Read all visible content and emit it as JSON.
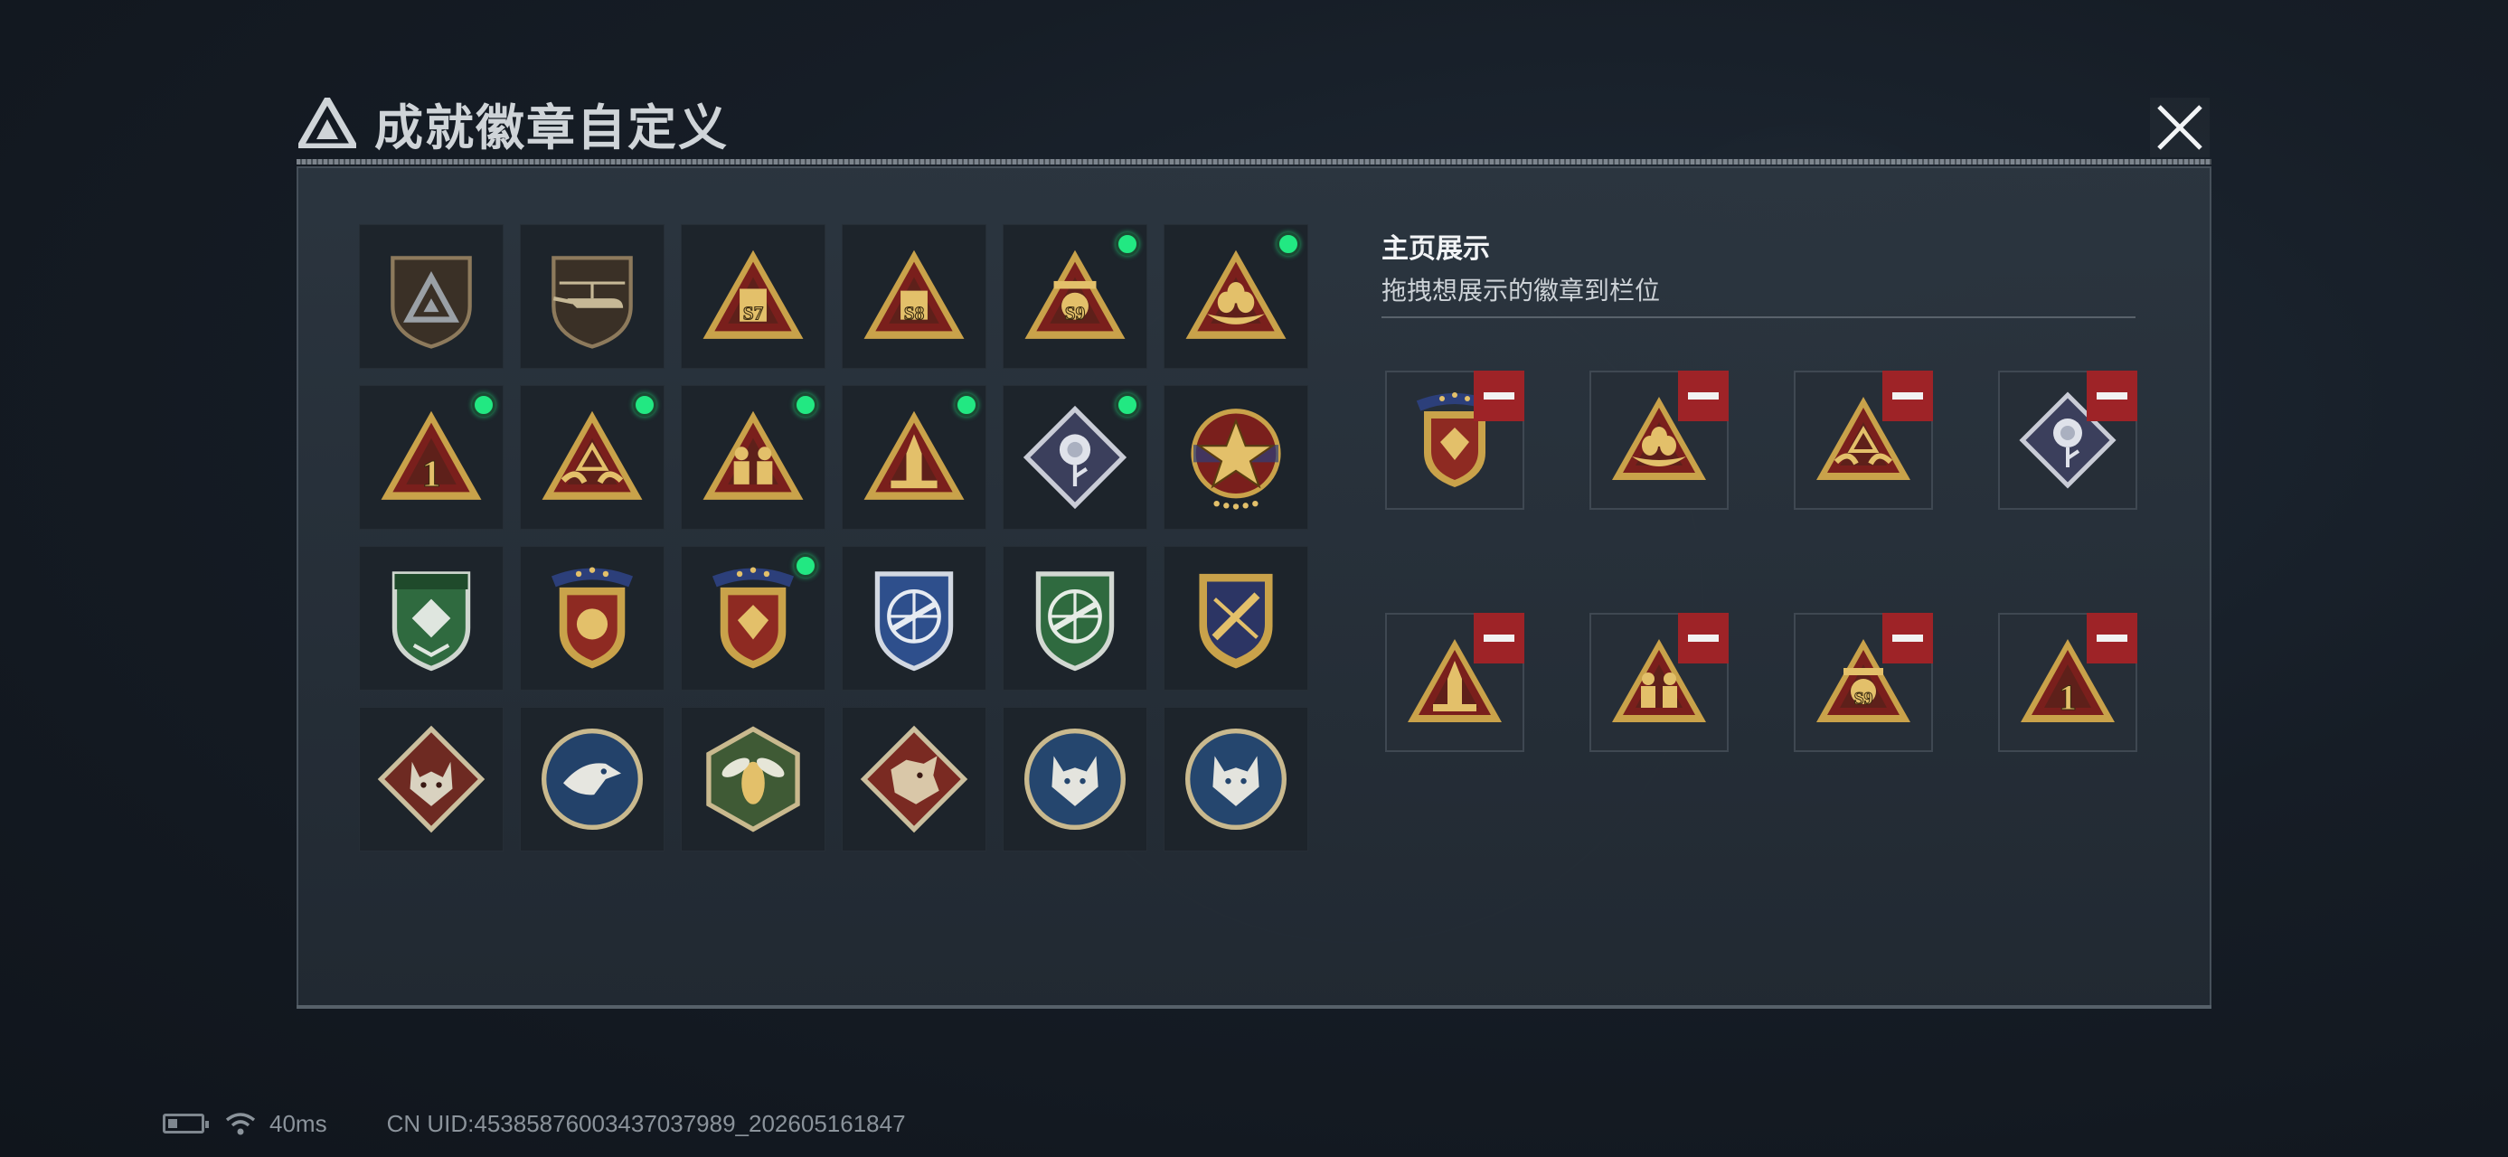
{
  "window": {
    "title": "成就徽章自定义"
  },
  "display_panel": {
    "title": "主页展示",
    "subtitle": "拖拽想展示的徽章到栏位"
  },
  "badges": [
    {
      "icon": "shield-logo-badge-icon",
      "new": false
    },
    {
      "icon": "helicopter-badge-icon",
      "new": false
    },
    {
      "icon": "triangle-s7-badge-icon",
      "new": false,
      "text": "S7"
    },
    {
      "icon": "triangle-s8-badge-icon",
      "new": false,
      "text": "S8"
    },
    {
      "icon": "triangle-s9-badge-icon",
      "new": true,
      "text": "S9"
    },
    {
      "icon": "triangle-eggs-badge-icon",
      "new": true
    },
    {
      "icon": "triangle-number-one-badge-icon",
      "new": true,
      "text": "1"
    },
    {
      "icon": "triangle-hands-badge-icon",
      "new": true
    },
    {
      "icon": "triangle-figures-badge-icon",
      "new": true
    },
    {
      "icon": "triangle-rocket-badge-icon",
      "new": true
    },
    {
      "icon": "diamond-rose-badge-icon",
      "new": true
    },
    {
      "icon": "star-medal-badge-icon",
      "new": false
    },
    {
      "icon": "green-shield-badge-icon",
      "new": false
    },
    {
      "icon": "gold-shield-red-badge-icon",
      "new": false
    },
    {
      "icon": "gold-shield-diamond-badge-icon",
      "new": true
    },
    {
      "icon": "blue-crosshair-shield-badge-icon",
      "new": false
    },
    {
      "icon": "green-crosshair-shield-badge-icon",
      "new": false
    },
    {
      "icon": "navy-rocket-shield-badge-icon",
      "new": false
    },
    {
      "icon": "diamond-wolf-badge-icon",
      "new": false
    },
    {
      "icon": "circle-eagle-badge-icon",
      "new": false
    },
    {
      "icon": "hexagon-hornet-badge-icon",
      "new": false
    },
    {
      "icon": "diamond-dragon-badge-icon",
      "new": false
    },
    {
      "icon": "circle-lynx-badge-icon",
      "new": false
    },
    {
      "icon": "circle-lynx-badge-icon",
      "new": false
    }
  ],
  "display_slots": [
    {
      "icon": "gold-shield-diamond-badge-icon"
    },
    {
      "icon": "triangle-eggs-badge-icon"
    },
    {
      "icon": "triangle-hands-badge-icon"
    },
    {
      "icon": "diamond-rose-badge-icon"
    },
    {
      "icon": "triangle-rocket-badge-icon"
    },
    {
      "icon": "triangle-figures-badge-icon"
    },
    {
      "icon": "triangle-s9-badge-icon",
      "text": "S9"
    },
    {
      "icon": "triangle-number-one-badge-icon",
      "text": "1"
    }
  ],
  "status_bar": {
    "ping": "40ms",
    "uid": "CN UID:45385876003437037989_202605161847"
  },
  "colors": {
    "new_indicator": "#22e882",
    "remove_button": "#9e2327",
    "badge_gold": "#c9a24a",
    "badge_red": "#7a1f1c"
  }
}
